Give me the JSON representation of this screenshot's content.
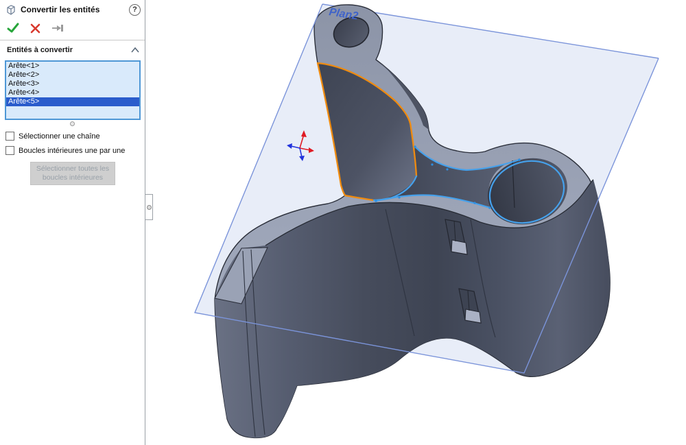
{
  "panel": {
    "title": "Convertir les entités",
    "help_glyph": "?",
    "icons": {
      "header": "convert-entities-cube-icon",
      "ok": "green-check-icon",
      "cancel": "red-x-icon",
      "pin": "push-pin-icon",
      "collapse": "chevron-up-icon"
    },
    "section_label": "Entités à convertir",
    "list": {
      "items": [
        "Arête<1>",
        "Arête<2>",
        "Arête<3>",
        "Arête<4>",
        "Arête<5>"
      ],
      "selected_index": 4
    },
    "checkboxes": [
      {
        "label": "Sélectionner une chaîne",
        "checked": false
      },
      {
        "label": "Boucles intérieures une par une",
        "checked": false
      }
    ],
    "disabled_button": {
      "line1": "Sélectionner toutes les",
      "line2": "boucles intérieures",
      "enabled": false
    }
  },
  "viewport": {
    "plane_label": "Plan2",
    "colors": {
      "selection_highlight": "#2a5ccc",
      "selected_edge_orange": "#ef8b10",
      "converted_edge_blue": "#45a1ec",
      "plane_edge_blue": "#7b94da",
      "plane_fill": "#e8edf8",
      "check_green": "#27a53a",
      "cancel_red": "#d8392e",
      "triad_red": "#e01b24",
      "triad_blue": "#2233dd"
    }
  }
}
